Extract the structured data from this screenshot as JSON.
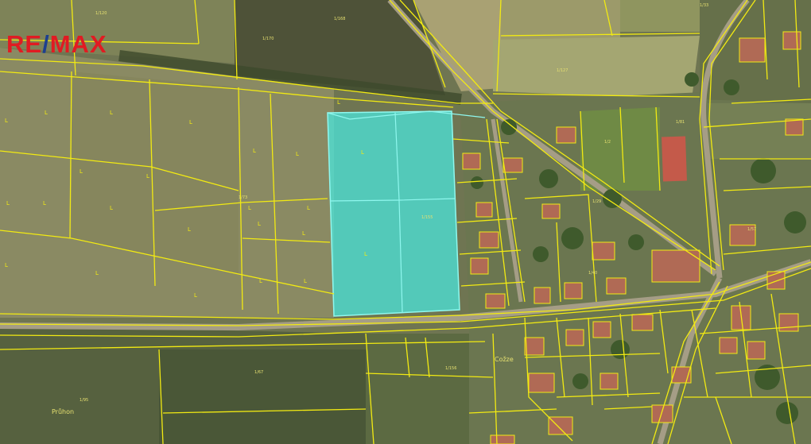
{
  "brand": {
    "logo_left": "RE",
    "logo_slash": "/",
    "logo_right": "MAX"
  },
  "place_names": {
    "prihon": "Průhon",
    "cozze": "Cožze"
  },
  "parcel_label": "L",
  "colors": {
    "parcel_line": "#f2ea12",
    "highlight_fill": "#49e6dc",
    "highlight_stroke": "#8ff7ee",
    "brand_red": "#e11b22",
    "brand_blue": "#1d3f8f"
  }
}
